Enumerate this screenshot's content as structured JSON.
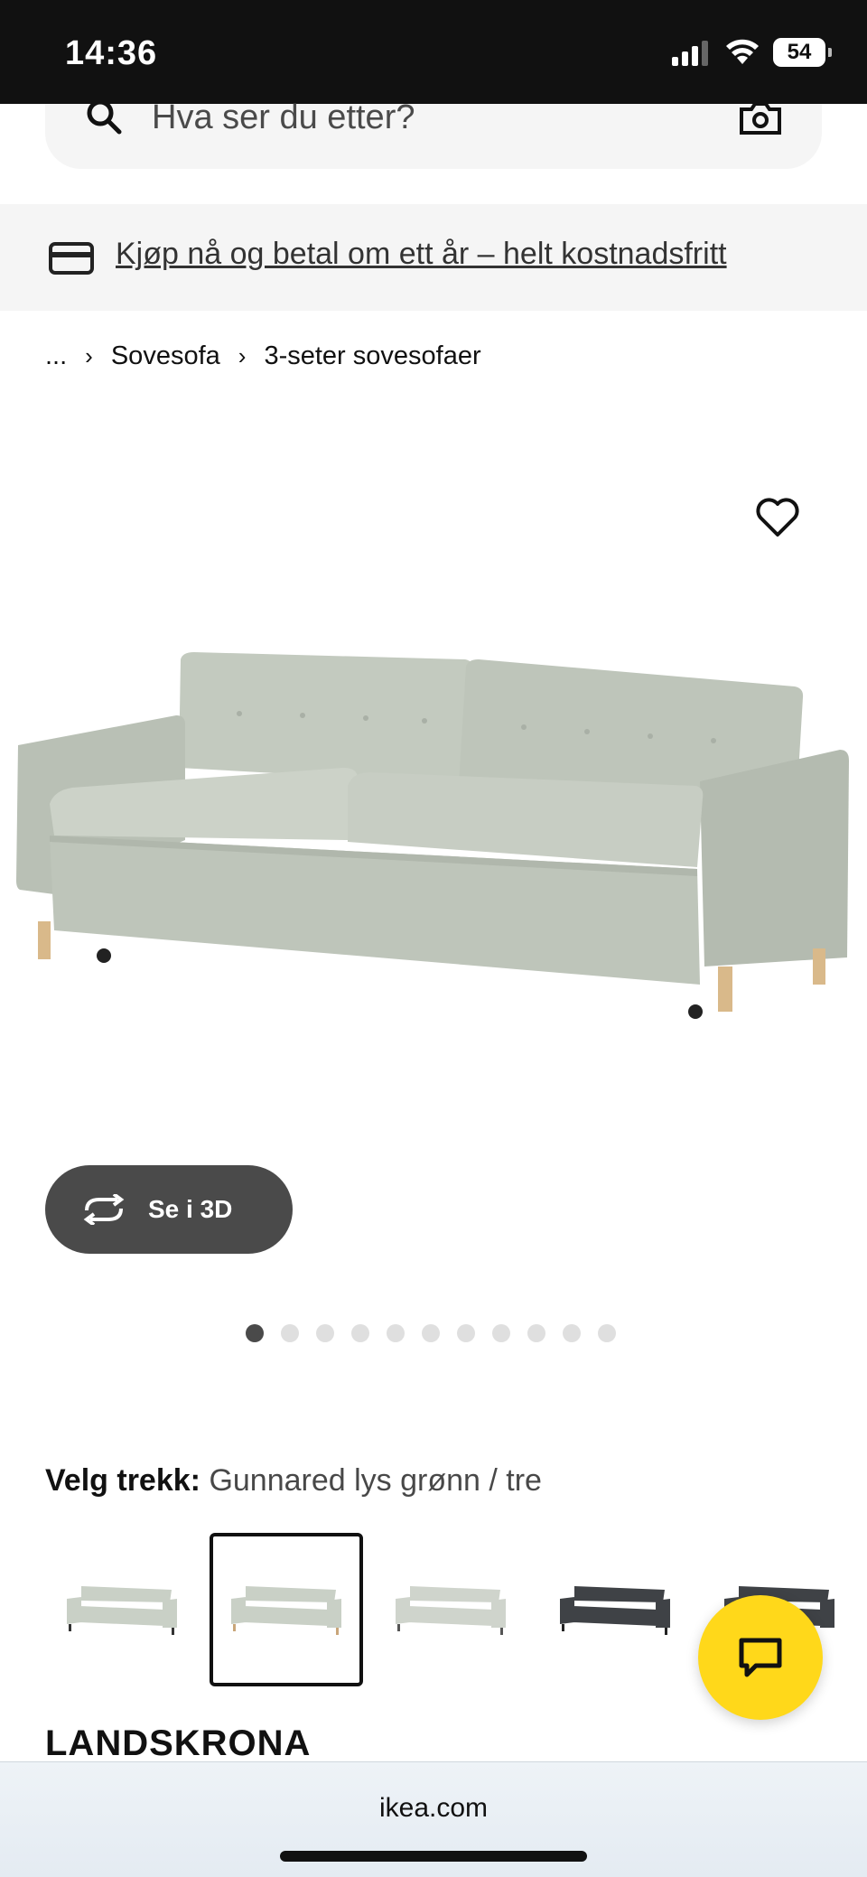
{
  "status_bar": {
    "time": "14:36",
    "battery": "54",
    "icons": [
      "signal-icon",
      "wifi-icon",
      "battery-icon"
    ]
  },
  "search": {
    "placeholder": "Hva ser du etter?"
  },
  "promo": {
    "text": "Kjøp nå og betal om ett år – helt kostnadsfritt"
  },
  "breadcrumb": {
    "items": [
      "...",
      "Sovesofa",
      "3-seter sovesofaer"
    ]
  },
  "gallery": {
    "view_3d_label": "Se i 3D",
    "image_count": 11,
    "active_index": 0
  },
  "variant": {
    "label": "Velg trekk:",
    "value": "Gunnared lys grønn / tre",
    "options": [
      {
        "color": "#c9d0c6"
      },
      {
        "color": "#c9d0c6",
        "selected": true
      },
      {
        "color": "#cfd4cc"
      },
      {
        "color": "#3f4246"
      },
      {
        "color": "#3f4246"
      }
    ]
  },
  "product": {
    "name": "LANDSKRONA"
  },
  "browser": {
    "url": "ikea.com"
  },
  "colors": {
    "chat_button": "#ffd81a",
    "sofa": "#c9d0c6",
    "dark_button": "#4a4a4a"
  }
}
